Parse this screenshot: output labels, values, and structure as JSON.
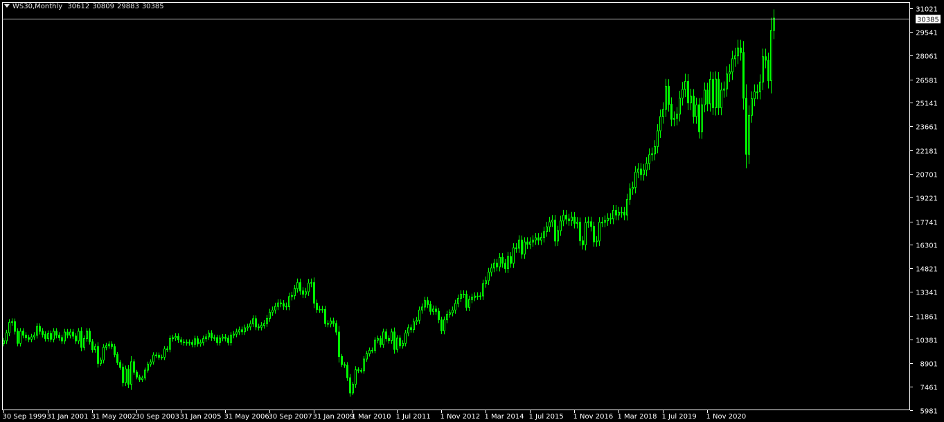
{
  "header": {
    "symbol": "WS30,Monthly",
    "open": "30612",
    "high": "30809",
    "low": "29883",
    "close": "30385"
  },
  "colors": {
    "background": "#000000",
    "axis": "#ffffff",
    "candle": "#00ff00",
    "price_line": "#c0c0c0",
    "text": "#ffffff"
  },
  "chart_data": {
    "type": "candlestick",
    "title": "WS30,Monthly",
    "timeframe": "Monthly",
    "x_start": "1999-09",
    "x_end": "2020-12",
    "ylim": [
      5981,
      31400
    ],
    "y_ticks": [
      "31021",
      "29541",
      "28061",
      "26581",
      "25141",
      "23661",
      "22181",
      "20701",
      "19221",
      "17741",
      "16301",
      "14821",
      "13341",
      "11861",
      "10381",
      "8901",
      "7461",
      "5981"
    ],
    "x_tick_labels": [
      "30 Sep 1999",
      "31 Jan 2001",
      "31 May 2002",
      "30 Sep 2003",
      "31 Jan 2005",
      "31 May 2006",
      "30 Sep 2007",
      "31 Jan 2009",
      "1 Mar 2010",
      "1 Jul 2011",
      "1 Nov 2012",
      "1 Mar 2014",
      "1 Jul 2015",
      "1 Nov 2016",
      "1 Mar 2018",
      "1 Jul 2019",
      "1 Nov 2020"
    ],
    "x_tick_dates": [
      "1999-09",
      "2001-01",
      "2002-05",
      "2003-09",
      "2005-01",
      "2006-05",
      "2007-09",
      "2009-01",
      "2010-03",
      "2011-07",
      "2012-11",
      "2014-03",
      "2015-07",
      "2016-11",
      "2018-03",
      "2019-07",
      "2020-11"
    ],
    "current_price": "30385",
    "closes": [
      10300,
      10800,
      11450,
      11500,
      10900,
      10150,
      10900,
      10650,
      10500,
      10400,
      10550,
      10650,
      11200,
      10900,
      10700,
      10450,
      10750,
      10400,
      10900,
      10650,
      10500,
      10300,
      10850,
      10650,
      10850,
      10600,
      10300,
      10900,
      9900,
      10450,
      10900,
      10250,
      9750,
      9950,
      8900,
      9100,
      9900,
      10000,
      10100,
      9950,
      9450,
      8950,
      8650,
      7700,
      8550,
      7600,
      9000,
      8350,
      8050,
      7890,
      7990,
      8480,
      8850,
      8990,
      9420,
      9410,
      9280,
      9280,
      9800,
      9780,
      10450,
      10490,
      10580,
      10360,
      10230,
      10190,
      10210,
      10190,
      10080,
      10430,
      10120,
      10200,
      10440,
      10550,
      10780,
      10490,
      10500,
      10200,
      10470,
      10540,
      10460,
      10200,
      10650,
      10720,
      10860,
      10990,
      10870,
      11110,
      11170,
      11370,
      11680,
      11170,
      11150,
      11260,
      11380,
      11700,
      12080,
      12220,
      12450,
      12660,
      12620,
      12460,
      12440,
      13060,
      13120,
      13550,
      13930,
      13410,
      13210,
      13360,
      13900,
      13930,
      12650,
      12260,
      12260,
      12260,
      11380,
      11350,
      11540,
      11380,
      10850,
      9330,
      8830,
      8780,
      8000,
      7060,
      7600,
      8500,
      8450,
      8440,
      9170,
      9500,
      9710,
      9710,
      10340,
      10440,
      10070,
      10860,
      10450,
      10320,
      10860,
      9770,
      10470,
      10000,
      10150,
      10790,
      11120,
      11010,
      11490,
      11580,
      12220,
      12410,
      12810,
      12570,
      12140,
      12280,
      12140,
      11610,
      10920,
      11610,
      11960,
      12050,
      12220,
      12630,
      12950,
      13210,
      13210,
      12390,
      12880,
      13010,
      13090,
      13090,
      13100,
      13860,
      14050,
      14580,
      14840,
      15130,
      14910,
      15500,
      15130,
      14810,
      15550,
      15130,
      16090,
      16080,
      16580,
      15700,
      16460,
      16320,
      16460,
      16580,
      16720,
      16570,
      16740,
      17100,
      17400,
      17710,
      17820,
      16520,
      17160,
      17770,
      18130,
      17890,
      17790,
      18010,
      17620,
      17690,
      16530,
      16280,
      17660,
      17720,
      17430,
      16470,
      16520,
      17690,
      17690,
      17790,
      17930,
      17900,
      18430,
      18140,
      18310,
      18310,
      18140,
      19120,
      19760,
      19860,
      20810,
      21000,
      20660,
      20940,
      21350,
      21890,
      21950,
      22400,
      23380,
      24270,
      24720,
      26150,
      25030,
      24100,
      24160,
      24420,
      25420,
      25960,
      26460,
      25120,
      25540,
      24270,
      25000,
      23330,
      25000,
      25920,
      25060,
      26590,
      24820,
      26600,
      24820,
      25920,
      25990,
      26920,
      27050,
      27870,
      28050,
      28540,
      28260,
      25410,
      21920,
      24350,
      25380,
      25810,
      25810,
      26420,
      28000,
      27780,
      26500,
      29640,
      30400
    ]
  }
}
